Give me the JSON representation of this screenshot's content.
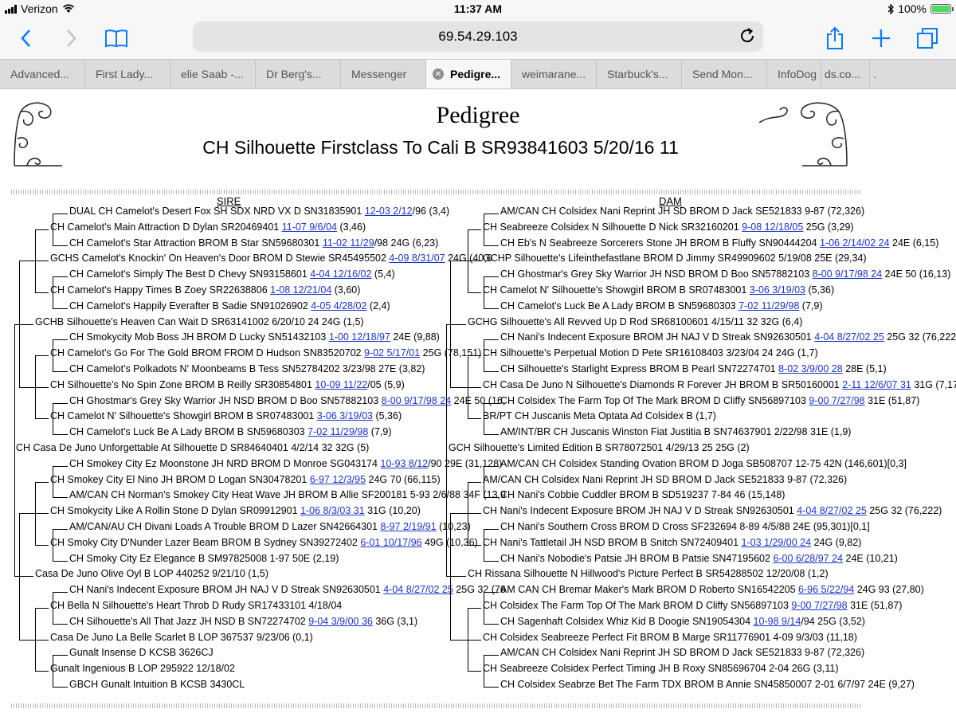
{
  "status_bar": {
    "carrier": "Verizon",
    "time": "11:37 AM",
    "battery": "100%",
    "battery_level": 1.0
  },
  "toolbar": {
    "url": "69.54.29.103"
  },
  "tabs": [
    {
      "label": "Advanced...",
      "active": false
    },
    {
      "label": "First Lady...",
      "active": false
    },
    {
      "label": "elie Saab -...",
      "active": false
    },
    {
      "label": "Dr Berg's...",
      "active": false
    },
    {
      "label": "Messenger",
      "active": false
    },
    {
      "label": "Pedigre...",
      "active": true
    },
    {
      "label": "weimarane...",
      "active": false
    },
    {
      "label": "Starbuck's...",
      "active": false
    },
    {
      "label": "Send Mon...",
      "active": false
    },
    {
      "label": "InfoDog -...",
      "active": false
    },
    {
      "label": "ds.co...",
      "active": false
    },
    {
      "label": ".",
      "active": false
    }
  ],
  "page": {
    "title": "Pedigree",
    "subtitle": "CH Silhouette Firstclass To Cali B SR93841603 5/20/16 11",
    "sire_heading": "SIRE",
    "dam_heading": "DAM"
  },
  "sire": [
    {
      "text": "DUAL CH Camelot's Desert Fox SH SDX NRD VX D SN31835901 ",
      "link": "12-03 2/12",
      "after": "/96 (3,4)"
    },
    {
      "text": "CH Camelot's Main Attraction D Dylan SR20469401 ",
      "link": "11-07 9/6/04",
      "after": " (3,46)"
    },
    {
      "text": "CH Camelot's Star Attraction BROM B Star SN59680301 ",
      "link": "11-02 11/29",
      "after": "/98 24G (6,23)"
    },
    {
      "text": "GCHS Camelot's Knockin' On Heaven's Door BROM D Stewie SR45495502 ",
      "link": "4-09 8/31/07",
      "after": " 24G (40,6"
    },
    {
      "text": "CH Camelot's Simply The Best D Chevy SN93158601 ",
      "link": "4-04 12/16/02",
      "after": " (5,4)"
    },
    {
      "text": "CH Camelot's Happy Times B Zoey SR22638806 ",
      "link": "1-08 12/21/04",
      "after": " (3,60)"
    },
    {
      "text": "CH Camelot's Happily Everafter B Sadie SN91026902 ",
      "link": "4-05 4/28/02",
      "after": " (2,4)"
    },
    {
      "text": "GCHB Silhouette's Heaven Can Wait D SR63141002 6/20/10 24 24G (1,5)",
      "link": "",
      "after": ""
    },
    {
      "text": "CH Smokycity Mob Boss JH BROM D Lucky SN51432103 ",
      "link": "1-00 12/18/97",
      "after": " 24E (9,88)"
    },
    {
      "text": "CH Camelot's Go For The Gold BROM FROM D Hudson SN83520702 ",
      "link": "9-02 5/17/01",
      "after": " 25G (78,151)"
    },
    {
      "text": "CH Camelot's Polkadots N' Moonbeams B Tess SN52784202 3/23/98 27E (3,82)",
      "link": "",
      "after": ""
    },
    {
      "text": "CH Silhouette's No Spin Zone BROM B Reilly SR30854801 ",
      "link": "10-09 11/22",
      "after": "/05 (5,9)"
    },
    {
      "text": "CH Ghostmar's Grey Sky Warrior JH NSD BROM D Boo SN57882103 ",
      "link": "8-00 9/17/98 24",
      "after": " 24E 50 (16,"
    },
    {
      "text": "CH Camelot N' Silhouette's Showgirl BROM B SR07483001 ",
      "link": "3-06 3/19/03",
      "after": " (5,36)"
    },
    {
      "text": "CH Camelot's Luck Be A Lady BROM B SN59680303 ",
      "link": "7-02 11/29/98",
      "after": " (7,9)"
    },
    {
      "text": "CH Casa De Juno Unforgettable At Silhouette D SR84640401 4/2/14 32 32G (5)",
      "link": "",
      "after": ""
    },
    {
      "text": "CH Smokey City Ez Moonstone JH NRD BROM D Monroe SG043174 ",
      "link": "10-93 8/12",
      "after": "/90 29E (31,128)"
    },
    {
      "text": "CH Smokey City El Nino JH BROM D Logan SN30478201 ",
      "link": "6-97 12/3/95",
      "after": " 24G 70 (66,115)"
    },
    {
      "text": "AM/CAN CH Norman's Smokey City Heat Wave JH BROM B Allie SF200181 5-93 2/6/88 34F (13,9",
      "link": "",
      "after": ""
    },
    {
      "text": "CH Smokycity Like A Rollin Stone D Dylan SR09912901 ",
      "link": "1-06 8/3/03 31",
      "after": " 31G (10,20)"
    },
    {
      "text": "AM/CAN/AU CH Divani Loads A Trouble BROM D Lazer SN42664301 ",
      "link": "8-97 2/19/91",
      "after": " (10,23)"
    },
    {
      "text": "CH Smoky City D'Nunder Lazer Beam BROM B Sydney SN39272402 ",
      "link": "6-01 10/17/96",
      "after": " 49G (10,36)"
    },
    {
      "text": "CH Smoky City Ez Elegance B SM97825008 1-97 50E (2,19)",
      "link": "",
      "after": ""
    },
    {
      "text": "Casa De Juno Olive Oyl B LOP 440252 9/21/10 (1,5)",
      "link": "",
      "after": ""
    },
    {
      "text": "CH Nani's Indecent Exposure BROM JH NAJ V D Streak SN92630501 ",
      "link": "4-04 8/27/02 25",
      "after": " 25G 32 (76"
    },
    {
      "text": "CH Bella N Silhouette's Heart Throb D Rudy SR17433101 4/18/04",
      "link": "",
      "after": ""
    },
    {
      "text": "CH Silhouette's All That Jazz JH NSD B SN72274702 ",
      "link": "9-04 3/9/00 36",
      "after": " 36G (3,1)"
    },
    {
      "text": "Casa De Juno La Belle Scarlet B LOP 367537 9/23/06 (0,1)",
      "link": "",
      "after": ""
    },
    {
      "text": "Gunalt Insense D KCSB 3626CJ",
      "link": "",
      "after": ""
    },
    {
      "text": "Gunalt Ingenious B LOP 295922 12/18/02",
      "link": "",
      "after": ""
    },
    {
      "text": "GBCH Gunalt Intuition B KCSB 3430CL",
      "link": "",
      "after": ""
    }
  ],
  "dam": [
    {
      "text": "AM/CAN CH Colsidex Nani Reprint JH SD BROM D Jack SE521833 9-87 (72,326)",
      "link": "",
      "after": ""
    },
    {
      "text": "CH Seabreeze Colsidex N Silhouette D Nick SR32160201 ",
      "link": "9-08 12/18/05",
      "after": " 25G (3,29)"
    },
    {
      "text": "CH Eb's N Seabreeze Sorcerers Stone JH BROM B Fluffy SN90444204 ",
      "link": "1-06 2/14/02 24",
      "after": " 24E (6,15)"
    },
    {
      "text": "GCHP Silhouette's Lifeinthefastlane BROM D Jimmy SR49909602 5/19/08 25E (29,34)",
      "link": "",
      "after": ""
    },
    {
      "text": "CH Ghostmar's Grey Sky Warrior JH NSD BROM D Boo SN57882103 ",
      "link": "8-00 9/17/98 24",
      "after": " 24E 50 (16,13)"
    },
    {
      "text": "CH Camelot N' Silhouette's Showgirl BROM B SR07483001 ",
      "link": "3-06 3/19/03",
      "after": " (5,36)"
    },
    {
      "text": "CH Camelot's Luck Be A Lady BROM B SN59680303 ",
      "link": "7-02 11/29/98",
      "after": " (7,9)"
    },
    {
      "text": "GCHG Silhouette's All Revved Up D Rod SR68100601 4/15/11 32 32G (6,4)",
      "link": "",
      "after": ""
    },
    {
      "text": "CH Nani's Indecent Exposure BROM JH NAJ V D Streak SN92630501 ",
      "link": "4-04 8/27/02 25",
      "after": " 25G 32 (76,222)"
    },
    {
      "text": "CH Silhouette's Perpetual Motion D Pete SR16108403 3/23/04 24 24G (1,7)",
      "link": "",
      "after": ""
    },
    {
      "text": "CH Silhouette's Starlight Express BROM B Pearl SN72274701 ",
      "link": "8-02 3/9/00 28",
      "after": " 28E (5,1)"
    },
    {
      "text": "CH Casa De Juno N Silhouette's Diamonds R Forever JH BROM B SR50160001 ",
      "link": "2-11 12/6/07 31",
      "after": " 31G (7,17)"
    },
    {
      "text": "CH Colsidex The Farm Top Of The Mark BROM D Cliffy SN56897103 ",
      "link": "9-00 7/27/98",
      "after": " 31E (51,87)"
    },
    {
      "text": "BR/PT CH Juscanis Meta Optata Ad Colsidex B (1,7)",
      "link": "",
      "after": ""
    },
    {
      "text": "AM/INT/BR CH Juscanis Winston Fiat Justitia B SN74637901 2/22/98 31E (1,9)",
      "link": "",
      "after": ""
    },
    {
      "text": "GCH Silhouette's Limited Edition B SR78072501 4/29/13 25 25G (2)",
      "link": "",
      "after": ""
    },
    {
      "text": "AM/CAN CH Colsidex Standing Ovation BROM D Joga SB508707 12-75 42N (146,601)[0,3]",
      "link": "",
      "after": ""
    },
    {
      "text": "AM/CAN CH Colsidex Nani Reprint JH SD BROM D Jack SE521833 9-87 (72,326)",
      "link": "",
      "after": ""
    },
    {
      "text": "CH Nani's Cobbie Cuddler BROM B SD519237 7-84 46 (15,148)",
      "link": "",
      "after": ""
    },
    {
      "text": "CH Nani's Indecent Exposure BROM JH NAJ V D Streak SN92630501 ",
      "link": "4-04 8/27/02 25",
      "after": " 25G 32 (76,222)"
    },
    {
      "text": "CH Nani's Southern Cross BROM D Cross SF232694 8-89 4/5/88 24E (95,301)[0,1]",
      "link": "",
      "after": ""
    },
    {
      "text": "CH Nani's Tattletail JH NSD BROM B Snitch SN72409401 ",
      "link": "1-03 1/29/00 24",
      "after": " 24G (9,82)"
    },
    {
      "text": "CH Nani's Nobodie's Patsie JH BROM B Patsie SN47195602 ",
      "link": "6-00 6/28/97 24",
      "after": " 24E (10,21)"
    },
    {
      "text": "CH Rissana Silhouette N Hillwood's Picture Perfect B SR54288502 12/20/08 (1,2)",
      "link": "",
      "after": ""
    },
    {
      "text": "AM CAN CH Bremar Maker's Mark BROM D Roberto SN16542205 ",
      "link": "6-96 5/22/94",
      "after": " 24G 93 (27,80)"
    },
    {
      "text": "CH Colsidex The Farm Top Of The Mark BROM D Cliffy SN56897103 ",
      "link": "9-00 7/27/98",
      "after": " 31E (51,87)"
    },
    {
      "text": "CH Sagenhaft Colsidex Whiz Kid B Doogie SN19054304 ",
      "link": "10-98 9/14",
      "after": "/94 25G (3,52)"
    },
    {
      "text": "CH Colsidex Seabreeze Perfect Fit BROM B Marge SR11776901 4-09 9/3/03 (11,18)",
      "link": "",
      "after": ""
    },
    {
      "text": "AM/CAN CH Colsidex Nani Reprint JH SD BROM D Jack SE521833 9-87 (72,326)",
      "link": "",
      "after": ""
    },
    {
      "text": "CH Seabreeze Colsidex Perfect Timing JH B Roxy SN85696704 2-04 26G (3,11)",
      "link": "",
      "after": ""
    },
    {
      "text": "CH Colsidex Seabrze Bet The Farm TDX BROM B Annie SN45850007 2-01 6/7/97 24E (9,27)",
      "link": "",
      "after": ""
    }
  ]
}
